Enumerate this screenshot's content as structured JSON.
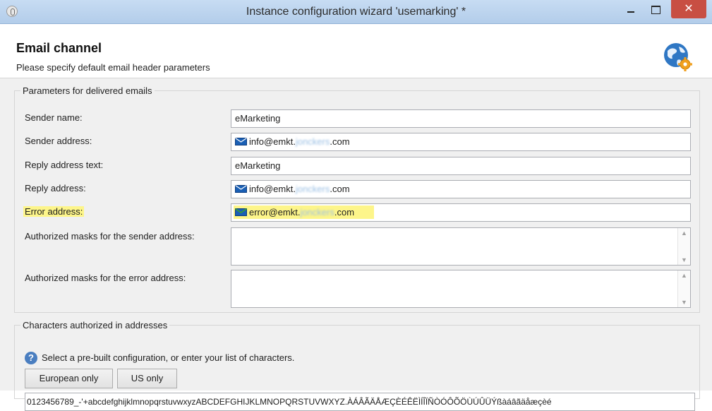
{
  "window": {
    "title": "Instance configuration wizard 'usemarking' *",
    "close_label": "✕"
  },
  "header": {
    "title": "Email channel",
    "subtitle": "Please specify default email header parameters",
    "icon": "globe-gear-icon"
  },
  "delivered": {
    "legend": "Parameters for delivered emails",
    "sender_name": {
      "label": "Sender name:",
      "value": "eMarketing"
    },
    "sender_address": {
      "label": "Sender address:",
      "prefix": "info@emkt.",
      "masked": "jonckers",
      "suffix": ".com"
    },
    "reply_text": {
      "label": "Reply address text:",
      "value": "eMarketing"
    },
    "reply_address": {
      "label": "Reply address:",
      "prefix": "info@emkt.",
      "masked": "jonckers",
      "suffix": ".com"
    },
    "error_address": {
      "label": "Error address:",
      "prefix": "error@emkt.",
      "masked": "jonckers",
      "suffix": ".com",
      "highlight_color": "#fdf58a"
    },
    "sender_masks": {
      "label": "Authorized masks for the sender address:",
      "value": ""
    },
    "error_masks": {
      "label": "Authorized masks for the error address:",
      "value": ""
    }
  },
  "characters": {
    "legend": "Characters authorized in addresses",
    "instruction": "Select a pre-built configuration, or enter your list of characters.",
    "european_label": "European only",
    "us_label": "US only",
    "value": "0123456789_-'+abcdefghijklmnopqrstuvwxyzABCDEFGHIJKLMNOPQRSTUVWXYZ.ÀÁÂÃÄÅÆÇÈÉÊËÌÍÎÏÑÒÓÔÕÖÙÚÛÜÝßàáâãäåæçèé"
  },
  "colors": {
    "accent": "#4a7ec0",
    "close": "#c84f43",
    "highlight": "#fdf58a"
  }
}
